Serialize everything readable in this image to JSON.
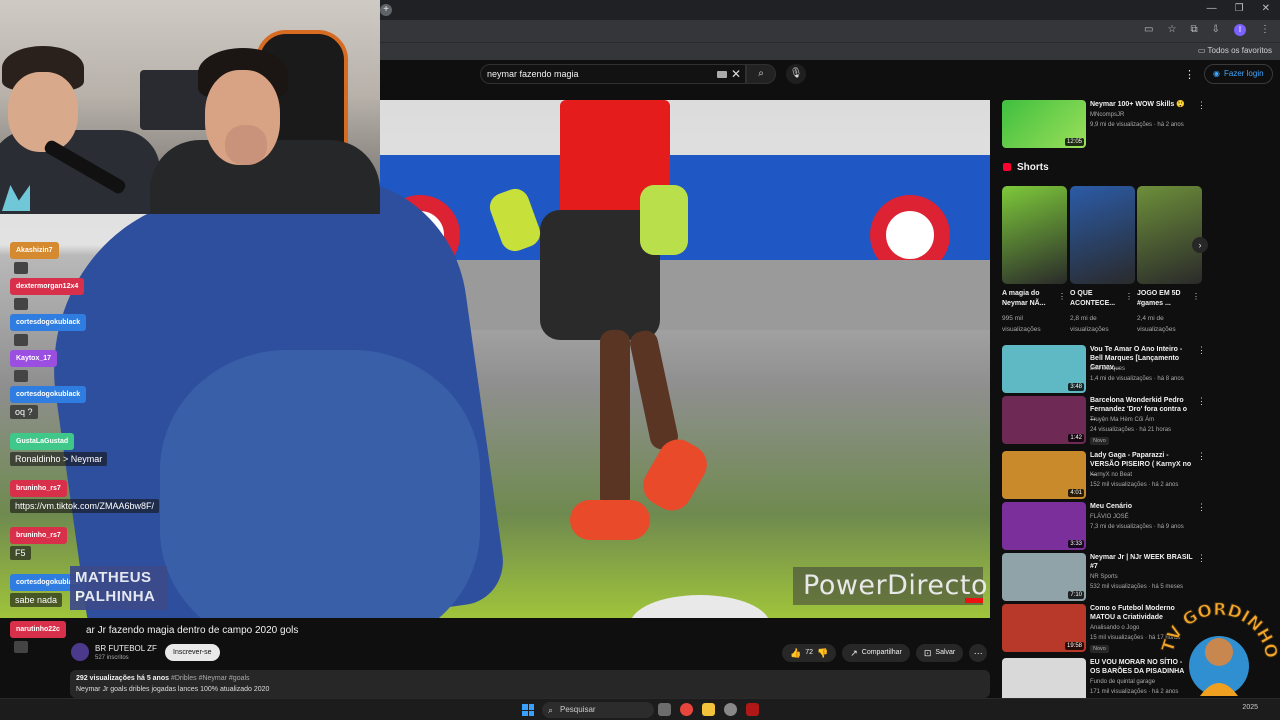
{
  "browser": {
    "new_tab": "+",
    "window_controls": [
      "—",
      "❐",
      "✕"
    ],
    "bookmarks_all": "Todos os favoritos",
    "profile_initial": "I"
  },
  "youtube": {
    "search_value": "neymar fazendo magia",
    "login_label": "Fazer login",
    "video": {
      "title": "ar Jr fazendo magia dentro de campo 2020 gols",
      "watermark": "PowerDirector",
      "channel_name": "BR FUTEBOL ZF",
      "subscribers": "527 inscritos",
      "subscribe_label": "Inscrever-se",
      "likes": "72",
      "share_label": "Compartilhar",
      "save_label": "Salvar",
      "views_date": "292 visualizações  há 5 anos",
      "tags": "#Dribles #Neymar #goals",
      "description": "Neymar Jr goals dribles jogadas lances 100% atualizado 2020"
    },
    "sidebar": {
      "top": {
        "title": "Neymar 100+ WOW Skills 😲",
        "channel": "MNcompsJR",
        "meta": "9,9 mi de visualizações · há 2 anos",
        "duration": "12:05"
      },
      "shorts_heading": "Shorts",
      "shorts": [
        {
          "title": "A magia do Neymar NÃ...",
          "views": "995 mil visualizações",
          "color": "#7dc93a"
        },
        {
          "title": "O QUE ACONTECE...",
          "views": "2,8 mi de visualizações",
          "color": "#2b5ba8"
        },
        {
          "title": "JOGO EM 5D #games ...",
          "views": "2,4 mi de visualizações",
          "color": "#6d8f3a"
        }
      ],
      "videos": [
        {
          "title": "Vou Te Amar O Ano Inteiro - Bell Marques [Lançamento Carnav...",
          "channel": "Bell Marques",
          "meta": "1,4 mi de visualizações · há 8 anos",
          "duration": "3:48",
          "color": "#5fb9c4",
          "new": ""
        },
        {
          "title": "Barcelona Wonderkid Pedro Fernandez 'Dro' fora contra o ...",
          "channel": "Truyện Ma Hèm Cối Ám",
          "meta": "24 visualizações · há 21 horas",
          "duration": "1:42",
          "color": "#6e2a55",
          "new": "Novo"
        },
        {
          "title": "Lady Gaga - Paparazzi - VERSÃO PISEIRO ( KarnyX no ...",
          "channel": "KarnyX no Beat",
          "meta": "152 mil visualizações · há 2 anos",
          "duration": "4:01",
          "color": "#c88a2a",
          "new": ""
        },
        {
          "title": "Meu Cenário",
          "channel": "FLÁVIO JOSÉ",
          "meta": "7,3 mi de visualizações · há 9 anos",
          "duration": "3:33",
          "color": "#7a2f9a",
          "new": ""
        },
        {
          "title": "Neymar Jr | NJr WEEK BRASIL #7",
          "channel": "NR Sports",
          "meta": "532 mil visualizações · há 5 meses",
          "duration": "7:10",
          "color": "#8fa3a8",
          "new": ""
        },
        {
          "title": "Como o Futebol Moderno MATOU a Criatividade",
          "channel": "Analisando o Jogo",
          "meta": "15 mil visualizações · há 17 horas",
          "duration": "19:58",
          "color": "#b8382a",
          "new": "Novo"
        },
        {
          "title": "EU VOU MORAR NO SÍTIO - OS BARÕES DA PISADINHA",
          "channel": "Fundo de quintal garage",
          "meta": "171 mil visualizações · há 2 anos",
          "duration": "",
          "color": "#d9d9d9",
          "new": ""
        }
      ]
    }
  },
  "chat": [
    {
      "user": "Akashizin7",
      "color": "#d68a2f",
      "msg": "",
      "emote": true
    },
    {
      "user": "dextermorgan12x4",
      "color": "#d8304a",
      "msg": "",
      "emote": true
    },
    {
      "user": "cortesdogokublack",
      "color": "#2f7de0",
      "msg": "",
      "emote": true
    },
    {
      "user": "Kaytox_17",
      "color": "#9b4fe0",
      "msg": "",
      "emote": true
    },
    {
      "user": "cortesdogokublack",
      "color": "#2f7de0",
      "msg": "oq ?",
      "emote": false
    },
    {
      "user": "GustaLaGustad",
      "color": "#3fc88a",
      "msg": "Ronaldinho > Neymar",
      "emote": false
    },
    {
      "user": "bruninho_rs7",
      "color": "#d8304a",
      "msg": "https://vm.tiktok.com/ZMAA6bw8F/",
      "emote": false
    },
    {
      "user": "bruninho_rs7",
      "color": "#d8304a",
      "msg": "F5",
      "emote": false
    },
    {
      "user": "cortesdogokublack",
      "color": "#2f7de0",
      "msg": "sabe nada",
      "emote": false
    },
    {
      "user": "narutinho22c",
      "color": "#d8304a",
      "msg": "",
      "emote": true
    }
  ],
  "overlay": {
    "name_line1": "MATHEUS",
    "name_line2": "PALHINHA",
    "logo_text": "TV GORDINHO"
  },
  "taskbar": {
    "search_label": "Pesquisar",
    "clock_year": "2025"
  }
}
